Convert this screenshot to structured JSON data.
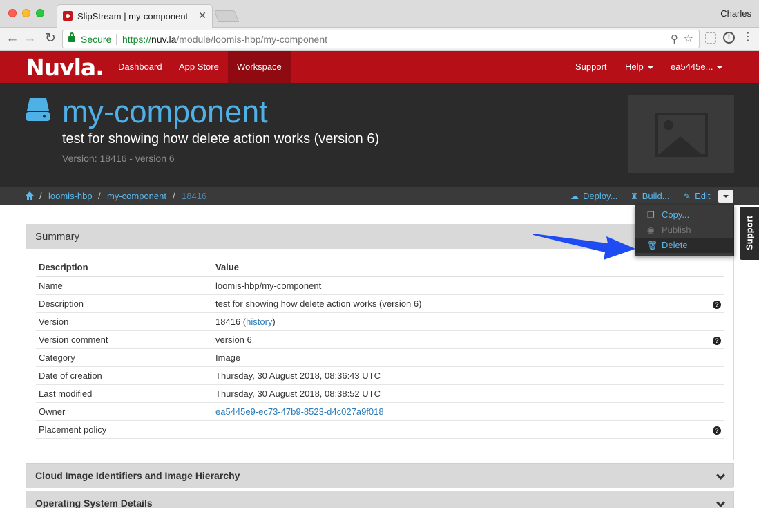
{
  "browser": {
    "tab_title": "SlipStream | my-component",
    "tab_close": "✕",
    "profile_name": "Charles",
    "secure_label": "Secure",
    "url_proto": "https://",
    "url_host": "nuv.la",
    "url_path": "/module/loomis-hbp/my-component"
  },
  "nav": {
    "logo": "Nuvla.",
    "links": {
      "dashboard": "Dashboard",
      "appstore": "App Store",
      "workspace": "Workspace",
      "support": "Support",
      "help": "Help",
      "user": "ea5445e..."
    }
  },
  "header": {
    "title": "my-component",
    "description": "test for showing how delete action works (version 6)",
    "version": "Version: 18416 - version 6"
  },
  "breadcrumb": {
    "items": [
      "loomis-hbp",
      "my-component",
      "18416"
    ],
    "separator": "/"
  },
  "actions": {
    "deploy": "Deploy...",
    "build": "Build...",
    "edit": "Edit"
  },
  "dropdown": {
    "copy": "Copy...",
    "publish": "Publish",
    "delete": "Delete"
  },
  "side_tab": "Support",
  "summary": {
    "title": "Summary",
    "headers": [
      "Description",
      "Value"
    ],
    "rows": [
      {
        "label": "Name",
        "value": "loomis-hbp/my-component"
      },
      {
        "label": "Description",
        "value": "test for showing how delete action works (version 6)"
      },
      {
        "label": "Version",
        "value": "18416",
        "link": "history"
      },
      {
        "label": "Version comment",
        "value": "version 6"
      },
      {
        "label": "Category",
        "value": "Image"
      },
      {
        "label": "Date of creation",
        "value": "Thursday, 30 August 2018, 08:36:43 UTC"
      },
      {
        "label": "Last modified",
        "value": "Thursday, 30 August 2018, 08:38:52 UTC"
      },
      {
        "label": "Owner",
        "value": "ea5445e9-ec73-47b9-8523-d4c027a9f018"
      },
      {
        "label": "Placement policy",
        "value": ""
      }
    ]
  },
  "panels": {
    "cloud": "Cloud Image Identifiers and Image Hierarchy",
    "os": "Operating System Details"
  },
  "colors": {
    "brand_red": "#b70f17",
    "link_blue": "#5bb8ee",
    "header_dark": "#2b2b2b",
    "arrow_blue": "#1e4bf2"
  }
}
